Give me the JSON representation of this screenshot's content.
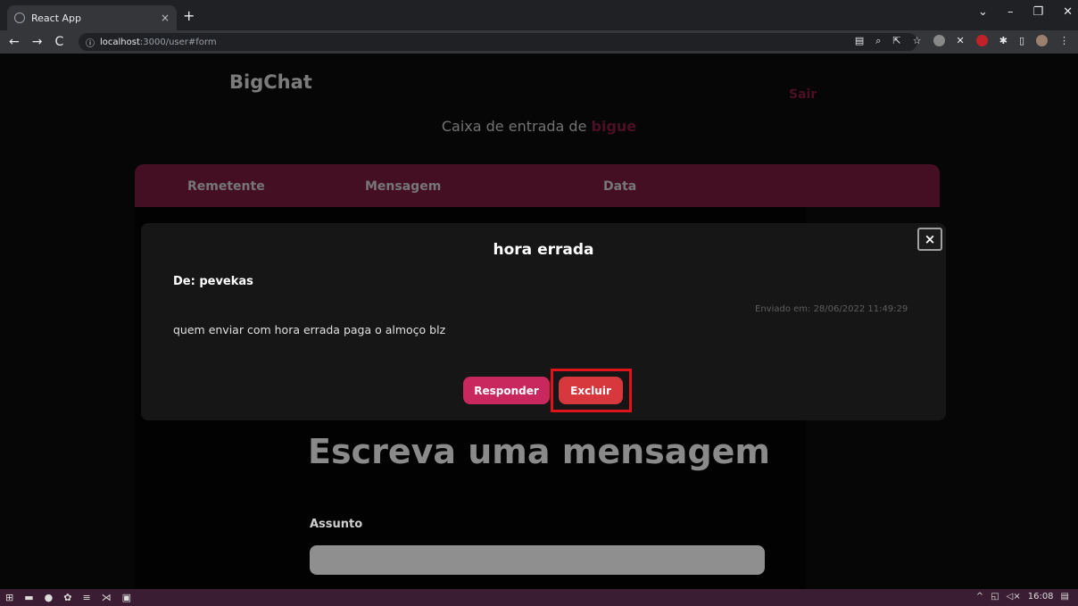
{
  "browser": {
    "tab_title": "React App",
    "tab_close": "×",
    "new_tab": "+",
    "url_host": "localhost",
    "url_path": ":3000/user#form",
    "back": "←",
    "forward": "→",
    "reload": "C",
    "info": "ⓘ",
    "window_controls": [
      "⌄",
      "–",
      "❐",
      "✕"
    ]
  },
  "header": {
    "brand": "BigChat",
    "logout": "Sair",
    "inbox_prefix": "Caixa de entrada de ",
    "inbox_user": "bigue"
  },
  "table": {
    "columns": [
      "Remetente",
      "Mensagem",
      "Data"
    ]
  },
  "modal": {
    "title": "hora errada",
    "from": "De: pevekas",
    "sent": "Enviado em: 28/06/2022 11:49:29",
    "body": "quem enviar com hora errada paga o almoço blz",
    "reply_label": "Responder",
    "delete_label": "Excluir",
    "close_label": "×"
  },
  "form": {
    "heading": "Escreva uma mensagem",
    "subject_label": "Assunto",
    "subject_value": ""
  },
  "taskbar": {
    "time": "16:08"
  },
  "colors": {
    "accent": "#7c1b40",
    "reply_button": "#c9285f",
    "delete_button": "#d6383d",
    "highlight": "#e0121a"
  }
}
